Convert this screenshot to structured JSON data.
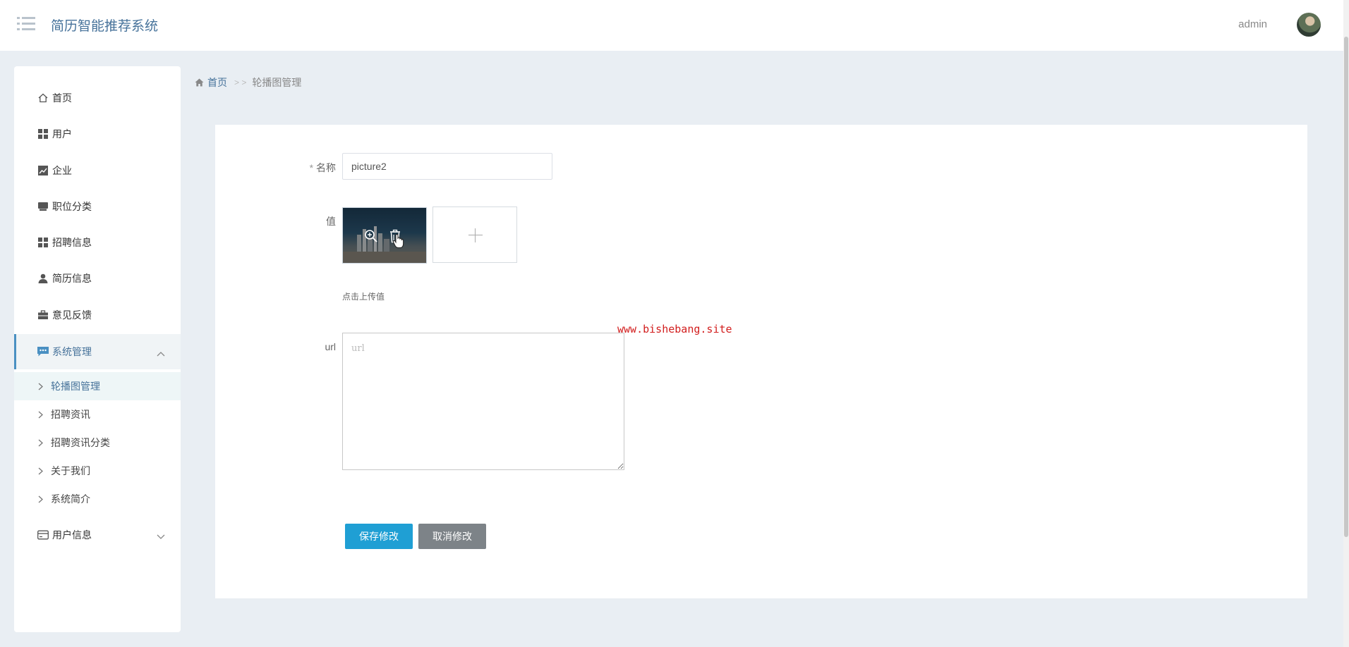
{
  "header": {
    "app_title": "简历智能推荐系统",
    "user": "admin"
  },
  "sidebar": {
    "items": [
      {
        "label": "首页",
        "icon": "home-icon"
      },
      {
        "label": "用户",
        "icon": "grid-icon"
      },
      {
        "label": "企业",
        "icon": "chart-icon"
      },
      {
        "label": "职位分类",
        "icon": "inbox-icon"
      },
      {
        "label": "招聘信息",
        "icon": "grid-icon"
      },
      {
        "label": "简历信息",
        "icon": "user-icon"
      },
      {
        "label": "意见反馈",
        "icon": "briefcase-icon"
      },
      {
        "label": "系统管理",
        "icon": "comment-icon"
      },
      {
        "label": "用户信息",
        "icon": "card-icon"
      }
    ],
    "submenu": [
      {
        "label": "轮播图管理"
      },
      {
        "label": "招聘资讯"
      },
      {
        "label": "招聘资讯分类"
      },
      {
        "label": "关于我们"
      },
      {
        "label": "系统简介"
      }
    ]
  },
  "breadcrumb": {
    "home": "首页",
    "separator": "> >",
    "current": "轮播图管理"
  },
  "form": {
    "name_required_mark": "*",
    "name_label": "名称",
    "name_value": "picture2",
    "value_label": "值",
    "upload_hint": "点击上传值",
    "url_label": "url",
    "url_placeholder": "url",
    "save_button": "保存修改",
    "cancel_button": "取消修改"
  },
  "watermark": "www.bishebang.site",
  "colors": {
    "accent": "#46729a",
    "save_button": "#1f9fd4",
    "cancel_button": "#7d8388",
    "watermark": "#d21e1e"
  }
}
